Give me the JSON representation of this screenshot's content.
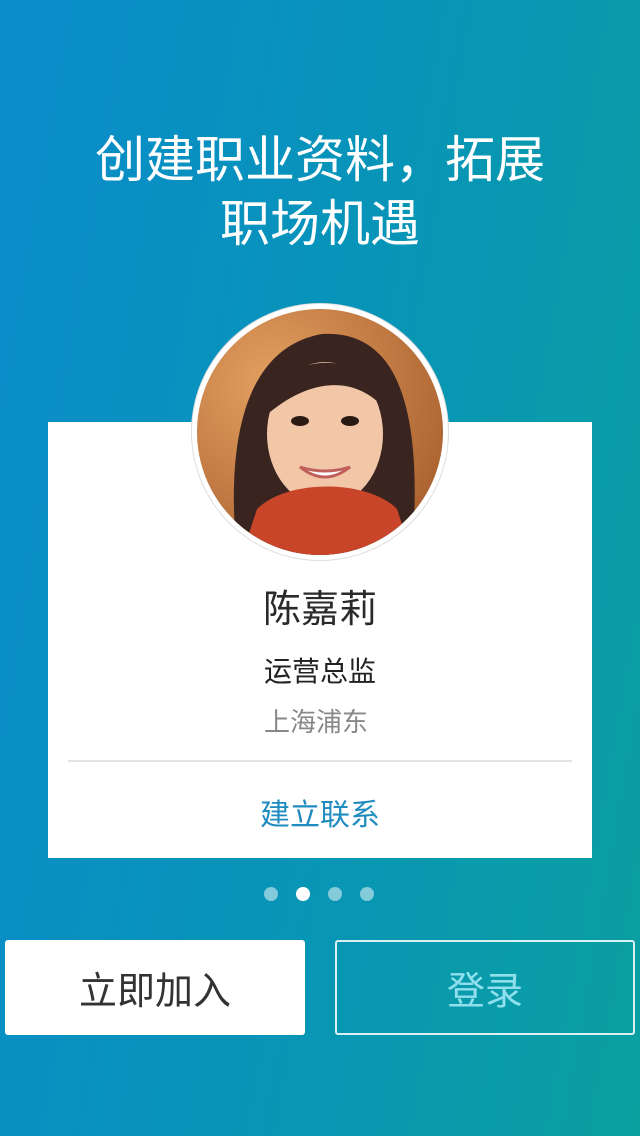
{
  "headline": {
    "line1": "创建职业资料，拓展",
    "line2": "职场机遇"
  },
  "profile": {
    "name": "陈嘉莉",
    "title": "运营总监",
    "location": "上海浦东",
    "connect_label": "建立联系"
  },
  "pager": {
    "count": 4,
    "active_index": 1
  },
  "buttons": {
    "join": "立即加入",
    "login": "登录"
  },
  "colors": {
    "accent": "#1f8bbf",
    "bg_start": "#0a8ccb",
    "bg_end": "#0aa0a0"
  }
}
